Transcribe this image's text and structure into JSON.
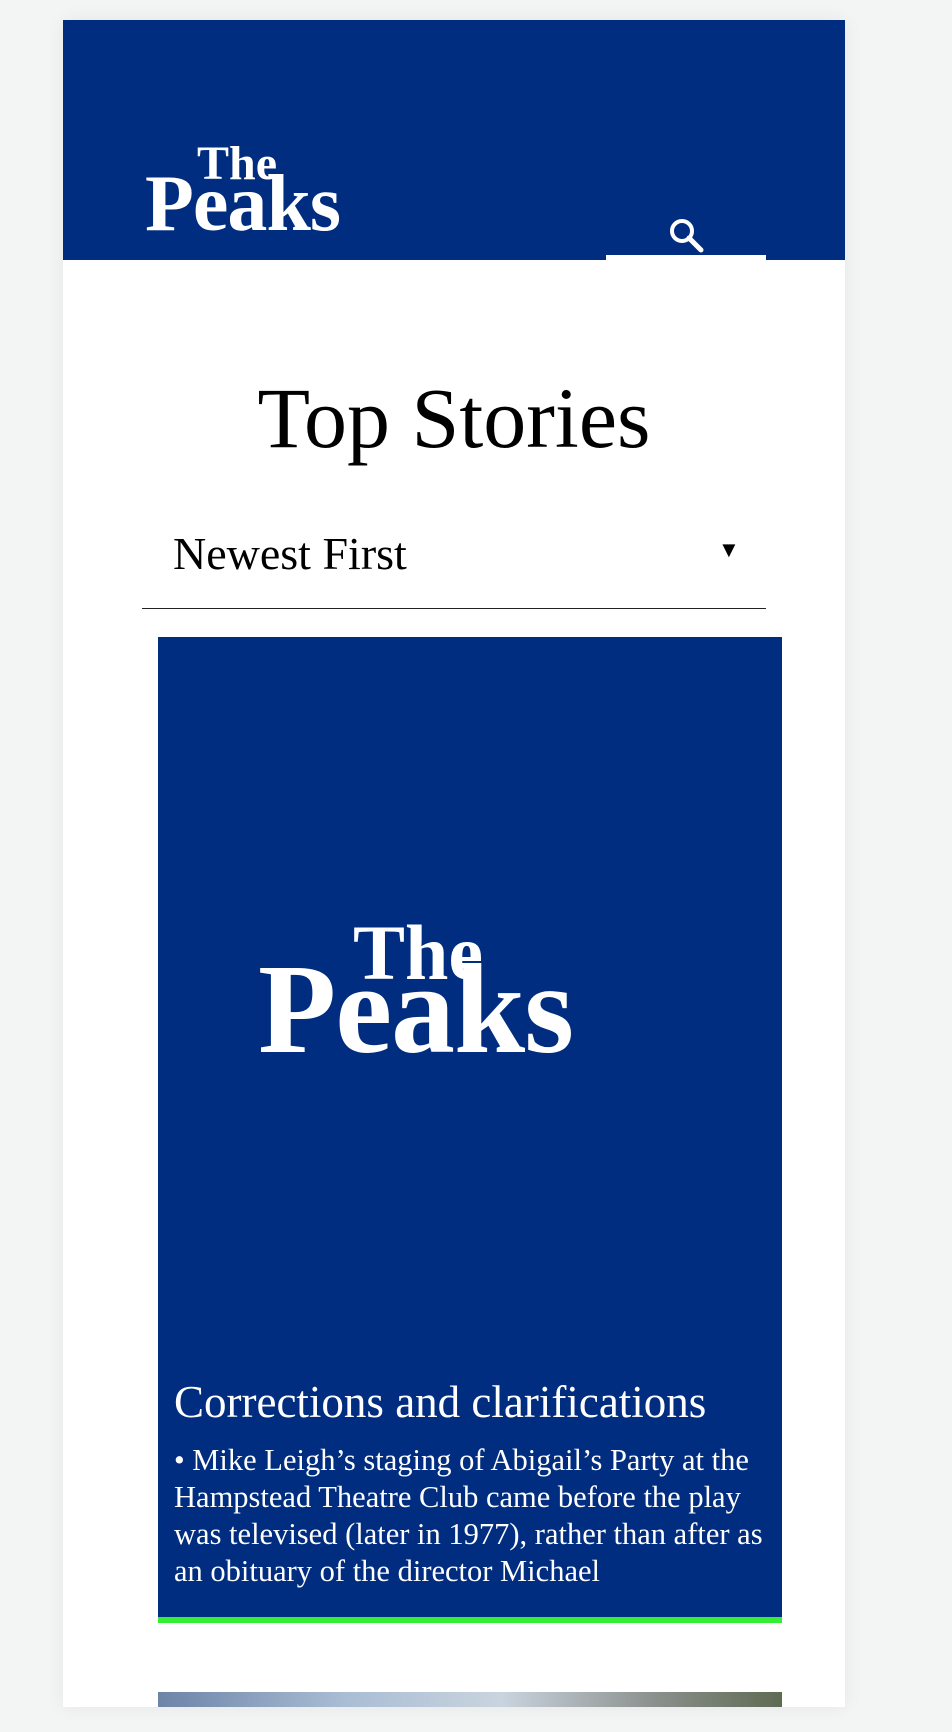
{
  "header": {
    "logo": {
      "the": "The",
      "peaks": "Peaks"
    },
    "search_icon": "search-icon",
    "background": "#002d7f"
  },
  "main": {
    "title": "Top Stories",
    "sort": {
      "selected": "Newest First",
      "caret": "▼"
    }
  },
  "stories": [
    {
      "image_logo": {
        "the": "The",
        "peaks": "Peaks"
      },
      "headline": "Corrections and clarifications",
      "excerpt": "• Mike Leigh’s staging of Abigail’s Party at the Hampstead Theatre Club came before the play was televised (later in 1977), rather than after as an obituary of the director Michael",
      "accent_color": "#33ee33"
    }
  ],
  "colors": {
    "brand": "#002d7f",
    "accent": "#33ee33",
    "page_bg": "#f3f4f4"
  }
}
